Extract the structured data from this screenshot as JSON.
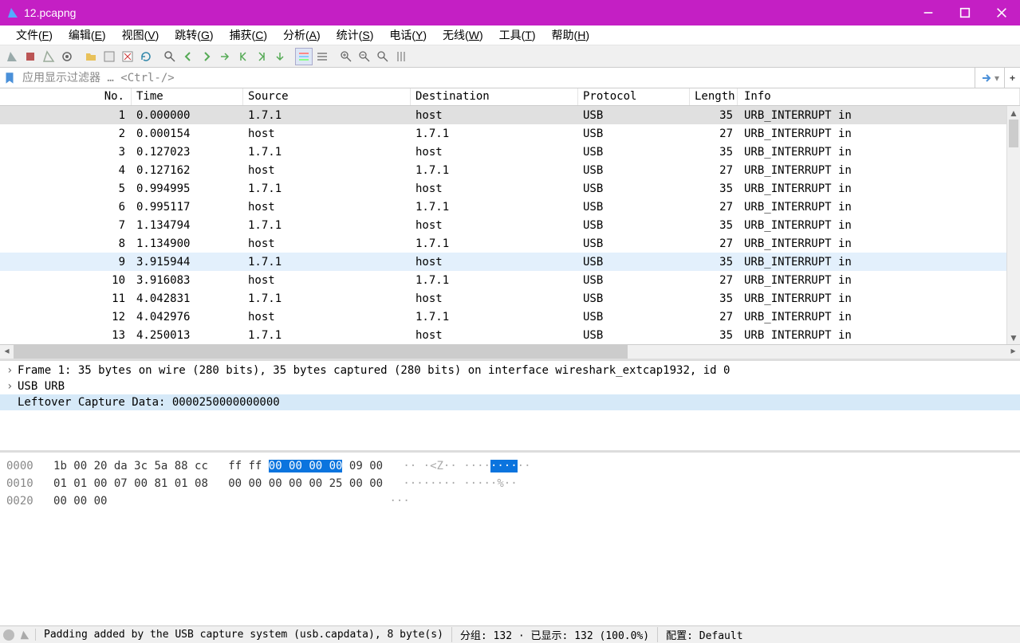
{
  "title": "12.pcapng",
  "menus": [
    "文件(F)",
    "编辑(E)",
    "视图(V)",
    "跳转(G)",
    "捕获(C)",
    "分析(A)",
    "统计(S)",
    "电话(Y)",
    "无线(W)",
    "工具(T)",
    "帮助(H)"
  ],
  "filter_placeholder": "应用显示过滤器 … <Ctrl-/>",
  "columns": {
    "no": "No.",
    "time": "Time",
    "src": "Source",
    "dst": "Destination",
    "proto": "Protocol",
    "len": "Length",
    "info": "Info"
  },
  "packets": [
    {
      "no": 1,
      "time": "0.000000",
      "src": "1.7.1",
      "dst": "host",
      "proto": "USB",
      "len": 35,
      "info": "URB_INTERRUPT in",
      "sel": true
    },
    {
      "no": 2,
      "time": "0.000154",
      "src": "host",
      "dst": "1.7.1",
      "proto": "USB",
      "len": 27,
      "info": "URB_INTERRUPT in"
    },
    {
      "no": 3,
      "time": "0.127023",
      "src": "1.7.1",
      "dst": "host",
      "proto": "USB",
      "len": 35,
      "info": "URB_INTERRUPT in"
    },
    {
      "no": 4,
      "time": "0.127162",
      "src": "host",
      "dst": "1.7.1",
      "proto": "USB",
      "len": 27,
      "info": "URB_INTERRUPT in"
    },
    {
      "no": 5,
      "time": "0.994995",
      "src": "1.7.1",
      "dst": "host",
      "proto": "USB",
      "len": 35,
      "info": "URB_INTERRUPT in"
    },
    {
      "no": 6,
      "time": "0.995117",
      "src": "host",
      "dst": "1.7.1",
      "proto": "USB",
      "len": 27,
      "info": "URB_INTERRUPT in"
    },
    {
      "no": 7,
      "time": "1.134794",
      "src": "1.7.1",
      "dst": "host",
      "proto": "USB",
      "len": 35,
      "info": "URB_INTERRUPT in"
    },
    {
      "no": 8,
      "time": "1.134900",
      "src": "host",
      "dst": "1.7.1",
      "proto": "USB",
      "len": 27,
      "info": "URB_INTERRUPT in"
    },
    {
      "no": 9,
      "time": "3.915944",
      "src": "1.7.1",
      "dst": "host",
      "proto": "USB",
      "len": 35,
      "info": "URB_INTERRUPT in",
      "mark": true
    },
    {
      "no": 10,
      "time": "3.916083",
      "src": "host",
      "dst": "1.7.1",
      "proto": "USB",
      "len": 27,
      "info": "URB_INTERRUPT in"
    },
    {
      "no": 11,
      "time": "4.042831",
      "src": "1.7.1",
      "dst": "host",
      "proto": "USB",
      "len": 35,
      "info": "URB_INTERRUPT in"
    },
    {
      "no": 12,
      "time": "4.042976",
      "src": "host",
      "dst": "1.7.1",
      "proto": "USB",
      "len": 27,
      "info": "URB_INTERRUPT in"
    },
    {
      "no": 13,
      "time": "4.250013",
      "src": "1.7.1",
      "dst": "host",
      "proto": "USB",
      "len": 35,
      "info": "URB INTERRUPT in"
    }
  ],
  "details": {
    "frame": "Frame 1: 35 bytes on wire (280 bits), 35 bytes captured (280 bits) on interface wireshark_extcap1932, id 0",
    "urb": "USB URB",
    "leftover": "Leftover Capture Data: 0000250000000000"
  },
  "hex": {
    "r0_off": "0000",
    "r0_a": "1b 00 20 da 3c 5a 88 cc",
    "r0_b1": "ff ff ",
    "r0_hl": "00 00 00 00",
    "r0_b2": " 09 00",
    "r0_asc1": "·· ·<Z·· ····",
    "r0_aschl": "····",
    "r0_asc2": "··",
    "r1_off": "0010",
    "r1_a": "01 01 00 07 00 81 01 08",
    "r1_b": "00 00 00 00 00 25 00 00",
    "r1_asc": "········ ·····%··",
    "r2_off": "0020",
    "r2_a": "00 00 00",
    "r2_asc": "···"
  },
  "status": {
    "hint": "Padding added by the USB capture system (usb.capdata), 8 byte(s)",
    "pkts": "分组: 132 · 已显示: 132 (100.0%)",
    "profile": "配置: Default"
  }
}
